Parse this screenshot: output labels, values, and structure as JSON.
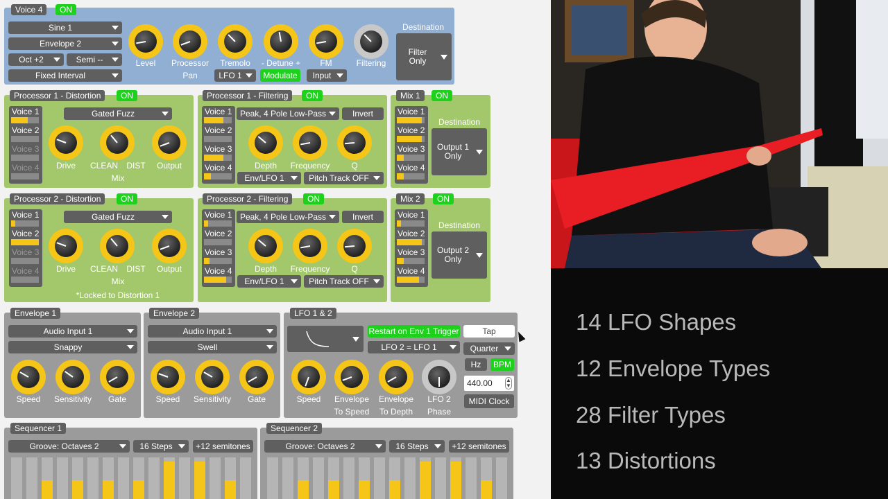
{
  "voice": {
    "title": "Voice 4",
    "on": "ON",
    "waveform": "Sine 1",
    "envelope": "Envelope 2",
    "octave": "Oct +2",
    "semi": "Semi --",
    "interval": "Fixed Interval",
    "knobs": [
      "Level",
      "Processor",
      "Tremolo",
      "- Detune +",
      "FM",
      "Filtering"
    ],
    "pan_label": "Pan",
    "lfo": "LFO 1",
    "modulate": "Modulate",
    "input": "Input",
    "destination_label": "Destination",
    "destination_line1": "Filter",
    "destination_line2": "Only"
  },
  "voices": [
    "Voice 1",
    "Voice 2",
    "Voice 3",
    "Voice 4"
  ],
  "p1dist": {
    "title": "Processor 1 - Distortion",
    "on": "ON",
    "type": "Gated Fuzz",
    "knobs": [
      "Drive",
      "CLEAN",
      "DIST",
      "Output"
    ],
    "mix": "Mix",
    "levels": [
      0.6,
      0,
      0,
      0
    ]
  },
  "p1filt": {
    "title": "Processor 1 - Filtering",
    "on": "ON",
    "type": "Peak, 4 Pole Low-Pass",
    "invert": "Invert",
    "knobs": [
      "Depth",
      "Frequency",
      "Q"
    ],
    "mod": "Env/LFO 1",
    "track": "Pitch Track OFF",
    "levels": [
      0.7,
      0,
      0.7,
      0.25
    ]
  },
  "mix1": {
    "title": "Mix 1",
    "on": "ON",
    "destination_label": "Destination",
    "destination_line1": "Output 1",
    "destination_line2": "Only",
    "levels": [
      0.9,
      0.9,
      0.25,
      0.25
    ]
  },
  "p2dist": {
    "title": "Processor 2 - Distortion",
    "on": "ON",
    "type": "Gated Fuzz",
    "knobs": [
      "Drive",
      "CLEAN",
      "DIST",
      "Output"
    ],
    "mix": "Mix",
    "note": "*Locked to Distortion 1",
    "levels": [
      0.15,
      1.0,
      0,
      0
    ]
  },
  "p2filt": {
    "title": "Processor 2 - Filtering",
    "on": "ON",
    "type": "Peak, 4 Pole Low-Pass",
    "invert": "Invert",
    "knobs": [
      "Depth",
      "Frequency",
      "Q"
    ],
    "mod": "Env/LFO 1",
    "track": "Pitch Track OFF",
    "levels": [
      0.15,
      0,
      0.2,
      0.8
    ]
  },
  "mix2": {
    "title": "Mix 2",
    "on": "ON",
    "destination_label": "Destination",
    "destination_line1": "Output 2",
    "destination_line2": "Only",
    "levels": [
      0.15,
      0.9,
      0.25,
      0.8
    ]
  },
  "env1": {
    "title": "Envelope 1",
    "input": "Audio Input 1",
    "shape": "Snappy",
    "knobs": [
      "Speed",
      "Sensitivity",
      "Gate"
    ]
  },
  "env2": {
    "title": "Envelope 2",
    "input": "Audio Input 1",
    "shape": "Swell",
    "knobs": [
      "Speed",
      "Sensitivity",
      "Gate"
    ]
  },
  "lfo": {
    "title": "LFO 1 & 2",
    "restart": "Restart on Env 1 Trigger",
    "tap": "Tap",
    "link": "LFO 2 = LFO 1",
    "division": "Quarter",
    "hz": "Hz",
    "bpm": "BPM",
    "rate": "440.00",
    "midi": "MIDI Clock",
    "knobs": [
      "Speed",
      "Envelope",
      "Envelope",
      "LFO 2"
    ],
    "knobs2": [
      "To Speed",
      "To Depth",
      "Phase"
    ]
  },
  "seq1": {
    "title": "Sequencer 1",
    "pattern": "Groove: Octaves 2",
    "steps": "16 Steps",
    "range": "+12 semitones"
  },
  "seq2": {
    "title": "Sequencer 2",
    "pattern": "Groove: Octaves 2",
    "steps": "16 Steps",
    "range": "+12 semitones"
  },
  "seq_levels": [
    0,
    0,
    0.45,
    0,
    0.45,
    0,
    0.45,
    0,
    0.45,
    0,
    0.9,
    0,
    0.9,
    0,
    0.45,
    0
  ],
  "features": [
    "14 LFO Shapes",
    "12 Envelope Types",
    "28 Filter Types",
    "13 Distortions"
  ],
  "colors": {
    "on": "#1dd11d",
    "knob": "#f5c518",
    "processor_panel": "#a3c86b",
    "voice_panel": "#90afd3",
    "modulation_panel": "#9b9b9b"
  }
}
